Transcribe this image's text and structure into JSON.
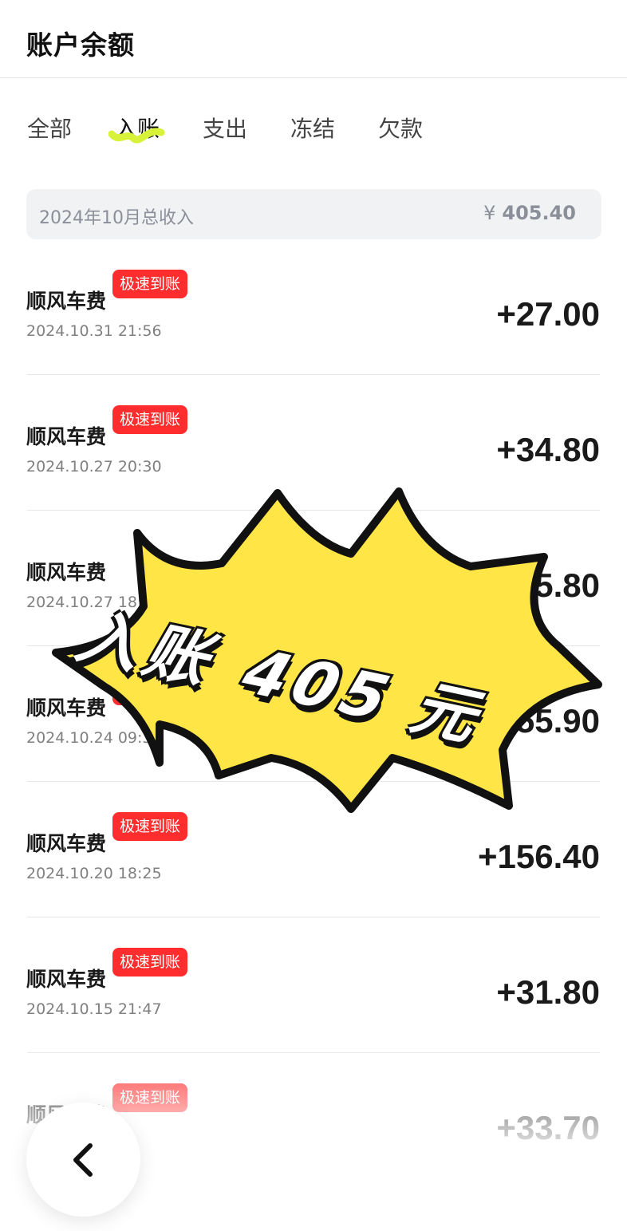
{
  "header": {
    "title": "账户余额"
  },
  "tabs": [
    {
      "label": "全部"
    },
    {
      "label": "入账"
    },
    {
      "label": "支出"
    },
    {
      "label": "冻结"
    },
    {
      "label": "欠款"
    }
  ],
  "active_tab": "入账",
  "summary": {
    "label": "2024年10月总收入",
    "currency": "¥",
    "amount": "405.40"
  },
  "transactions": [
    {
      "title": "顺风车费",
      "badge": "极速到账",
      "time": "2024.10.31 21:56",
      "amount": "+27.00"
    },
    {
      "title": "顺风车费",
      "badge": "极速到账",
      "time": "2024.10.27 20:30",
      "amount": "+34.80"
    },
    {
      "title": "顺风车费",
      "badge": "",
      "time": "2024.10.27 18:1",
      "amount": "5.80"
    },
    {
      "title": "顺风车费",
      "badge": "极",
      "time": "2024.10.24 09:34",
      "amount": "55.90"
    },
    {
      "title": "顺风车费",
      "badge": "极速到账",
      "time": "2024.10.20 18:25",
      "amount": "+156.40"
    },
    {
      "title": "顺风车费",
      "badge": "极速到账",
      "time": "2024.10.15 21:47",
      "amount": "+31.80"
    },
    {
      "title": "顺风车费",
      "badge": "极速到账",
      "time": "",
      "amount": "+33.70"
    }
  ],
  "overlay": {
    "text": "入账 405 元",
    "fill": "#ffe545",
    "stroke": "#111111"
  },
  "colors": {
    "badge": "#ff2d2d",
    "highlight": "#d8f23a"
  },
  "icons": {
    "back": "chevron-left-icon"
  }
}
